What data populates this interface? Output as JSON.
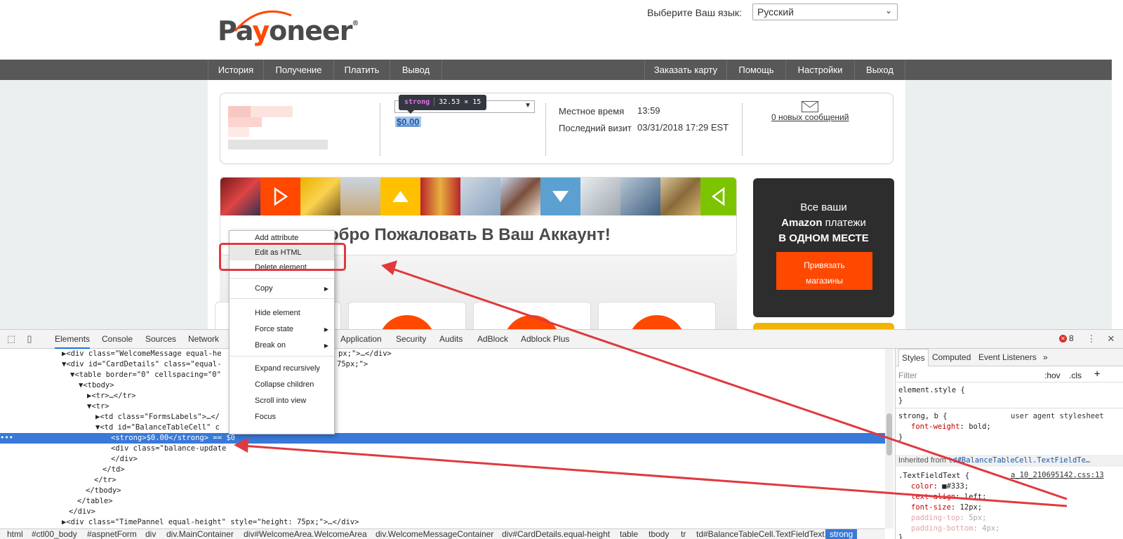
{
  "site": {
    "logo": {
      "pre": "Pa",
      "o": "y",
      "post": "oneer",
      "mark": "®"
    },
    "lang_label": "Выберите Ваш язык:",
    "lang_value": "Русский",
    "nav_left": [
      "История",
      "Получение",
      "Платить",
      "Вывод"
    ],
    "nav_right": [
      "Заказать карту",
      "Помощь",
      "Настройки",
      "Выход"
    ],
    "tooltip_tag": "strong",
    "tooltip_size": "32.53 × 15",
    "balance": "$0.00",
    "local_time_label": "Местное время",
    "local_time_value": "13:59",
    "last_visit_label": "Последний визит",
    "last_visit_value": "03/31/2018 17:29 EST",
    "messages_link": "0 новых сообщений",
    "welcome": "обро Пожаловать В Ваш Аккаунт!",
    "promo": {
      "line1": "Все ваши",
      "line2_bold": "Amazon",
      "line2_rest": " платежи",
      "line3": "В ОДНОМ МЕСТЕ",
      "button_line1": "Привязать",
      "button_line2": "магазины"
    }
  },
  "context_menu": {
    "items": [
      {
        "label": "Add attribute",
        "sub": false
      },
      {
        "label": "Edit as HTML",
        "sub": false
      },
      {
        "label": "Delete element",
        "sub": false
      },
      {
        "label": "Copy",
        "sub": true
      },
      {
        "label": "Hide element",
        "sub": false
      },
      {
        "label": "Force state",
        "sub": true
      },
      {
        "label": "Break on",
        "sub": true
      },
      {
        "label": "Expand recursively",
        "sub": false
      },
      {
        "label": "Collapse children",
        "sub": false
      },
      {
        "label": "Scroll into view",
        "sub": false
      },
      {
        "label": "Focus",
        "sub": false
      }
    ]
  },
  "devtools": {
    "tabs": [
      "Elements",
      "Console",
      "Sources",
      "Network",
      "Application",
      "Security",
      "Audits",
      "AdBlock",
      "Adblock Plus"
    ],
    "error_count": "8",
    "dom_lines": [
      {
        "text": "▶<div class=\"WelcomeMessage equal-he",
        "tail": "px;\">…</div>"
      },
      {
        "text": "▼<div id=\"CardDetails\" class=\"equal-",
        "tail": "75px;\">"
      },
      {
        "text": "▼<table border=\"0\" cellspacing=\"0\"",
        "tail": ""
      },
      {
        "text": "▼<tbody>",
        "tail": ""
      },
      {
        "text": "▶<tr>…</tr>",
        "tail": ""
      },
      {
        "text": "▼<tr>",
        "tail": ""
      },
      {
        "text": "▶<td class=\"FormsLabels\">…</",
        "tail": ""
      },
      {
        "text": "▼<td id=\"BalanceTableCell\" c",
        "tail": ""
      },
      {
        "text": "<strong>$0.00</strong> == $0",
        "tail": ""
      },
      {
        "text": "<div class=\"balance-update",
        "tail": ""
      },
      {
        "text": "</div>",
        "tail": ""
      },
      {
        "text": "</td>",
        "tail": ""
      },
      {
        "text": "</tr>",
        "tail": ""
      },
      {
        "text": "</tbody>",
        "tail": ""
      },
      {
        "text": "</table>",
        "tail": ""
      },
      {
        "text": "</div>",
        "tail": ""
      },
      {
        "text": "▶<div class=\"TimePannel equal-height\" style=\"height: 75px;\">…</div>",
        "tail": ""
      }
    ],
    "styles_tabs": [
      "Styles",
      "Computed",
      "Event Listeners",
      "»"
    ],
    "filter_placeholder": "Filter",
    "filter_hov": ":hov",
    "filter_cls": ".cls",
    "filter_plus": "+",
    "element_style_open": "element.style {",
    "close_brace": "}",
    "rule1_selector": "strong, b {",
    "rule1_source": "user agent stylesheet",
    "rule1_prop": "font-weight",
    "rule1_value": "bold;",
    "inherited_from": "Inherited from",
    "inherited_selector": "td#BalanceTableCell.TextFieldTe…",
    "rule2_selector": ".TextFieldText {",
    "rule2_source": "a_10_210695142.css:13",
    "rule2_props": [
      {
        "prop": "color",
        "value": "■#333;",
        "dim": false
      },
      {
        "prop": "text-align",
        "value": "left;",
        "dim": false
      },
      {
        "prop": "font-size",
        "value": "12px;",
        "dim": false
      },
      {
        "prop": "padding-top",
        "value": "5px;",
        "dim": true
      },
      {
        "prop": "padding-bottom",
        "value": "4px;",
        "dim": true
      }
    ],
    "breadcrumbs": [
      "html",
      "#ctl00_body",
      "#aspnetForm",
      "div",
      "div.MainContainer",
      "div#WelcomeArea.WelcomeArea",
      "div.WelcomeMessageContainer",
      "div#CardDetails.equal-height",
      "table",
      "tbody",
      "tr",
      "td#BalanceTableCell.TextFieldText",
      "strong"
    ]
  },
  "colors": {
    "accent": "#ff4800",
    "nav": "#585858",
    "selection": "#3879d9",
    "annotation": "#e0393e"
  }
}
